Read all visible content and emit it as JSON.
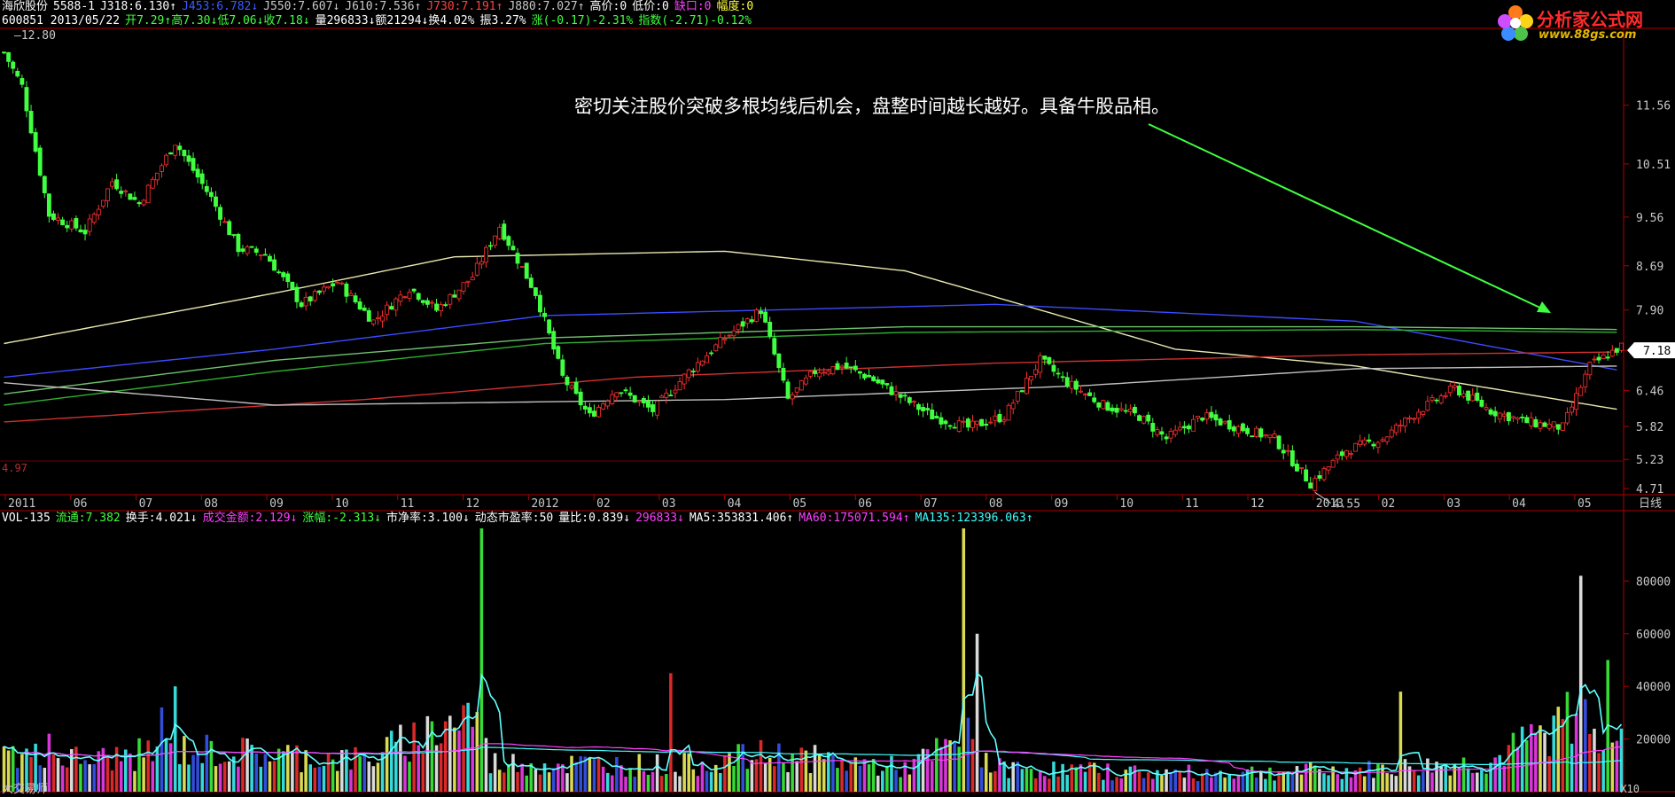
{
  "header": {
    "row1": [
      {
        "text": "海欣股份",
        "color": "#ffffff"
      },
      {
        "text": "5588-1",
        "color": "#ffffff"
      },
      {
        "text": "J318:6.130↑",
        "color": "#ffffff"
      },
      {
        "text": "J453:6.782↓",
        "color": "#3b5bff"
      },
      {
        "text": "J550:7.607↓",
        "color": "#c8c8c8"
      },
      {
        "text": "J610:7.536↑",
        "color": "#c8c8c8"
      },
      {
        "text": "J730:7.191↑",
        "color": "#ff4040"
      },
      {
        "text": "J880:7.027↑",
        "color": "#c8c8c8"
      },
      {
        "text": "高价:0",
        "color": "#ffffff"
      },
      {
        "text": "低价:0",
        "color": "#ffffff"
      },
      {
        "text": "缺口:0",
        "color": "#ff40ff"
      },
      {
        "text": "幅度:0",
        "color": "#ffff40"
      }
    ],
    "row2": [
      {
        "text": "600851 2013/05/22",
        "color": "#ffffff"
      },
      {
        "text": "开7.29↑高7.30↓低7.06↓收7.18↓",
        "color": "#40ff40"
      },
      {
        "text": "量296833↓额21294↓换4.02%",
        "color": "#ffffff"
      },
      {
        "text": "振3.27%",
        "color": "#ffffff"
      },
      {
        "text": "涨(-0.17)-2.31%",
        "color": "#40ff40"
      },
      {
        "text": "指数(-2.71)-0.12%",
        "color": "#40ff40"
      }
    ]
  },
  "logo": {
    "name": "分析家公式网",
    "url": "www.88gs.com"
  },
  "annotation": "密切关注股价突破多根均线后机会，盘整时间越长越好。具备牛股品相。",
  "volume_header": [
    {
      "text": "VOL-135",
      "color": "#ffffff"
    },
    {
      "text": "流通:7.382",
      "color": "#40ff40"
    },
    {
      "text": "换手:4.021↓",
      "color": "#ffffff"
    },
    {
      "text": "成交金额:2.129↓",
      "color": "#ff40ff"
    },
    {
      "text": "涨幅:-2.313↓",
      "color": "#40ff40"
    },
    {
      "text": "市净率:3.100↓",
      "color": "#ffffff"
    },
    {
      "text": "动态市盈率:50",
      "color": "#ffffff"
    },
    {
      "text": "量比:0.839↓",
      "color": "#ffffff"
    },
    {
      "text": "296833↓",
      "color": "#ff40ff"
    },
    {
      "text": "MA5:353831.406↑",
      "color": "#ffffff"
    },
    {
      "text": "MA60:175071.594↑",
      "color": "#ff40ff"
    },
    {
      "text": "MA135:123396.063↑",
      "color": "#40ffff"
    }
  ],
  "footer": "大交易师",
  "x10_label": "X10",
  "colors": {
    "up": "#ff3030",
    "down": "#40ff40",
    "axis": "#b00000",
    "bg": "#000000"
  },
  "chart_data": [
    {
      "type": "candlestick",
      "yticks": [
        11.56,
        10.51,
        9.56,
        8.69,
        7.9,
        7.18,
        6.46,
        5.82,
        5.23,
        4.71
      ],
      "ylim": [
        4.6,
        12.9
      ],
      "top_label": "12.80",
      "low_label": "4.55",
      "left_label": "4.97",
      "last_price": "7.18",
      "period_label": "日线",
      "xticks": [
        "2011",
        "06",
        "07",
        "08",
        "09",
        "10",
        "11",
        "12",
        "2012",
        "02",
        "03",
        "04",
        "05",
        "06",
        "07",
        "08",
        "09",
        "10",
        "11",
        "12",
        "2013",
        "02",
        "03",
        "04",
        "05"
      ],
      "close_profile": [
        [
          0,
          12.5
        ],
        [
          4,
          11.9
        ],
        [
          10,
          9.6
        ],
        [
          18,
          9.3
        ],
        [
          24,
          10.2
        ],
        [
          30,
          9.8
        ],
        [
          38,
          10.9
        ],
        [
          46,
          9.9
        ],
        [
          52,
          9.0
        ],
        [
          58,
          8.9
        ],
        [
          66,
          8.0
        ],
        [
          74,
          8.4
        ],
        [
          82,
          7.7
        ],
        [
          90,
          8.3
        ],
        [
          96,
          7.9
        ],
        [
          104,
          8.5
        ],
        [
          110,
          9.4
        ],
        [
          118,
          8.2
        ],
        [
          124,
          6.7
        ],
        [
          130,
          6.0
        ],
        [
          136,
          6.5
        ],
        [
          144,
          6.1
        ],
        [
          152,
          6.8
        ],
        [
          160,
          7.4
        ],
        [
          168,
          7.9
        ],
        [
          174,
          6.3
        ],
        [
          180,
          6.8
        ],
        [
          186,
          6.9
        ],
        [
          192,
          6.7
        ],
        [
          198,
          6.4
        ],
        [
          206,
          6.0
        ],
        [
          214,
          5.8
        ],
        [
          222,
          6.0
        ],
        [
          230,
          7.0
        ],
        [
          236,
          6.6
        ],
        [
          244,
          6.2
        ],
        [
          252,
          6.0
        ],
        [
          258,
          5.6
        ],
        [
          266,
          6.0
        ],
        [
          274,
          5.8
        ],
        [
          282,
          5.6
        ],
        [
          290,
          4.8
        ],
        [
          298,
          5.4
        ],
        [
          306,
          5.6
        ],
        [
          314,
          6.1
        ],
        [
          322,
          6.5
        ],
        [
          330,
          6.1
        ],
        [
          338,
          5.9
        ],
        [
          346,
          5.8
        ],
        [
          352,
          6.9
        ],
        [
          360,
          7.3
        ]
      ],
      "ma_lines": [
        {
          "name": "J318",
          "color": "#e8e8b0",
          "points": [
            [
              0,
              7.3
            ],
            [
              60,
              8.2
            ],
            [
              100,
              8.85
            ],
            [
              160,
              8.95
            ],
            [
              200,
              8.6
            ],
            [
              260,
              7.2
            ],
            [
              300,
              6.9
            ],
            [
              360,
              6.1
            ]
          ]
        },
        {
          "name": "J453",
          "color": "#3b4bff",
          "points": [
            [
              0,
              6.7
            ],
            [
              60,
              7.2
            ],
            [
              120,
              7.8
            ],
            [
              220,
              8.0
            ],
            [
              300,
              7.7
            ],
            [
              360,
              6.8
            ]
          ]
        },
        {
          "name": "J550",
          "color": "#30b030",
          "points": [
            [
              0,
              6.2
            ],
            [
              60,
              6.8
            ],
            [
              120,
              7.3
            ],
            [
              200,
              7.5
            ],
            [
              300,
              7.55
            ],
            [
              360,
              7.5
            ]
          ]
        },
        {
          "name": "J610",
          "color": "#70c070",
          "points": [
            [
              0,
              6.4
            ],
            [
              60,
              7.0
            ],
            [
              120,
              7.4
            ],
            [
              200,
              7.6
            ],
            [
              300,
              7.6
            ],
            [
              360,
              7.55
            ]
          ]
        },
        {
          "name": "J730",
          "color": "#d03030",
          "points": [
            [
              0,
              5.9
            ],
            [
              80,
              6.3
            ],
            [
              140,
              6.7
            ],
            [
              220,
              6.95
            ],
            [
              300,
              7.1
            ],
            [
              360,
              7.15
            ]
          ]
        },
        {
          "name": "J880",
          "color": "#c0c0c0",
          "points": [
            [
              0,
              6.6
            ],
            [
              60,
              6.2
            ],
            [
              160,
              6.3
            ],
            [
              240,
              6.55
            ],
            [
              300,
              6.85
            ],
            [
              360,
              6.9
            ]
          ]
        }
      ]
    },
    {
      "type": "bar",
      "yticks": [
        80000,
        60000,
        40000,
        20000
      ],
      "ylim": [
        0,
        100000
      ],
      "volume_profile": [
        [
          0,
          14000
        ],
        [
          20,
          12000
        ],
        [
          40,
          16000
        ],
        [
          80,
          12000
        ],
        [
          104,
          30000
        ],
        [
          108,
          11000
        ],
        [
          150,
          10000
        ],
        [
          170,
          14000
        ],
        [
          200,
          9000
        ],
        [
          214,
          20000
        ],
        [
          220,
          9000
        ],
        [
          260,
          7000
        ],
        [
          300,
          8000
        ],
        [
          330,
          11000
        ],
        [
          350,
          30000
        ],
        [
          360,
          20000
        ]
      ],
      "spikes": [
        [
          10,
          22000
        ],
        [
          35,
          32000
        ],
        [
          38,
          40000
        ],
        [
          106,
          100000
        ],
        [
          148,
          45000
        ],
        [
          213,
          100000
        ],
        [
          216,
          60000
        ],
        [
          310,
          38000
        ],
        [
          350,
          82000
        ],
        [
          356,
          50000
        ]
      ]
    }
  ]
}
